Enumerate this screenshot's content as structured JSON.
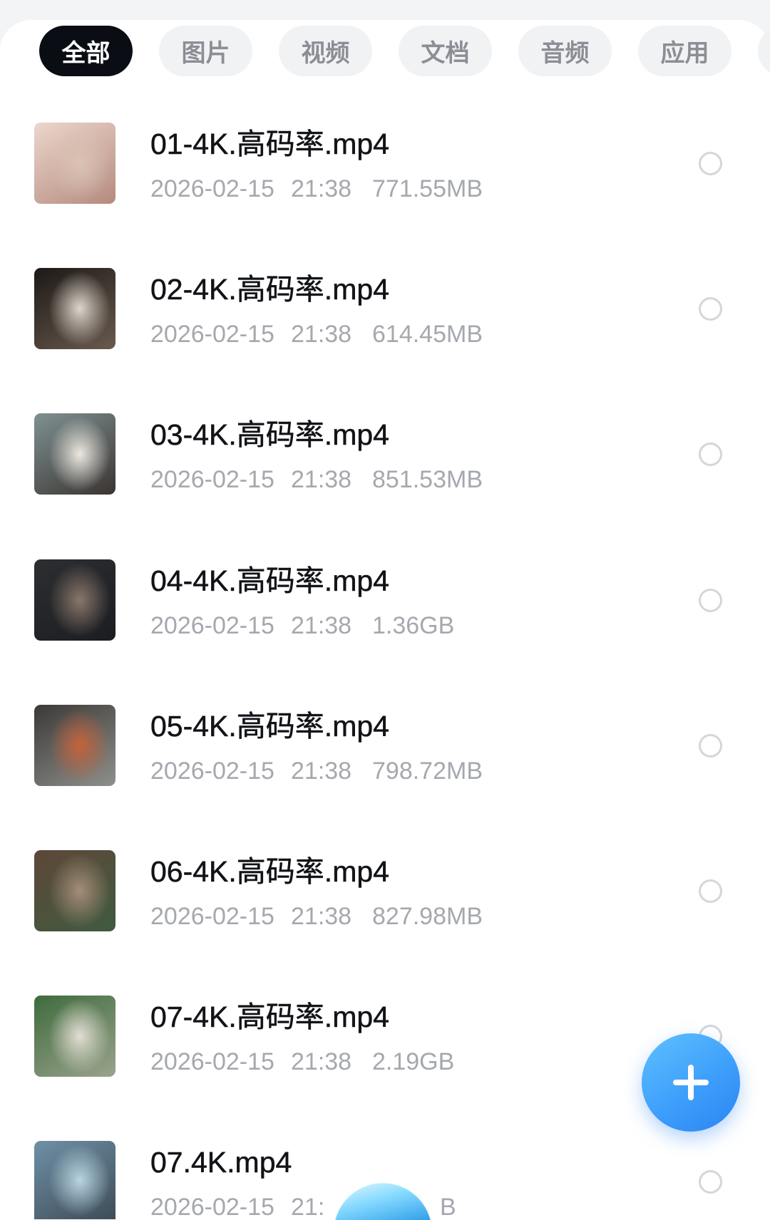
{
  "tabs": [
    {
      "label": "全部",
      "active": true
    },
    {
      "label": "图片",
      "active": false
    },
    {
      "label": "视频",
      "active": false
    },
    {
      "label": "文档",
      "active": false
    },
    {
      "label": "音频",
      "active": false
    },
    {
      "label": "应用",
      "active": false
    }
  ],
  "files": [
    {
      "name": "01-4K.高码率.mp4",
      "date": "2026-02-15",
      "time": "21:38",
      "size": "771.55MB",
      "thumb_colors": [
        "#ecd6cc",
        "#b48b7e",
        "#d9c2b4"
      ]
    },
    {
      "name": "02-4K.高码率.mp4",
      "date": "2026-02-15",
      "time": "21:38",
      "size": "614.45MB",
      "thumb_colors": [
        "#1d1917",
        "#6a5a4e",
        "#dcd6cc"
      ]
    },
    {
      "name": "03-4K.高码率.mp4",
      "date": "2026-02-15",
      "time": "21:38",
      "size": "851.53MB",
      "thumb_colors": [
        "#7f9192",
        "#3a3431",
        "#ece8e0"
      ]
    },
    {
      "name": "04-4K.高码率.mp4",
      "date": "2026-02-15",
      "time": "21:38",
      "size": "1.36GB",
      "thumb_colors": [
        "#2c2e31",
        "#1b1d21",
        "#8a776a"
      ]
    },
    {
      "name": "05-4K.高码率.mp4",
      "date": "2026-02-15",
      "time": "21:38",
      "size": "798.72MB",
      "thumb_colors": [
        "#3b3937",
        "#8e908c",
        "#c4633b"
      ]
    },
    {
      "name": "06-4K.高码率.mp4",
      "date": "2026-02-15",
      "time": "21:38",
      "size": "827.98MB",
      "thumb_colors": [
        "#5e4738",
        "#3f5b40",
        "#a48d78"
      ]
    },
    {
      "name": "07-4K.高码率.mp4",
      "date": "2026-02-15",
      "time": "21:38",
      "size": "2.19GB",
      "thumb_colors": [
        "#3e6b3d",
        "#9aa38c",
        "#e2ded3"
      ]
    },
    {
      "name": "07.4K.mp4",
      "date": "2026-02-15",
      "time": "21:",
      "size": "B",
      "thumb_colors": [
        "#6f90a6",
        "#3e4c58",
        "#b9d5e0"
      ]
    }
  ],
  "fab": {
    "icon": "plus-icon"
  },
  "floating_assistant": {
    "icon": "assistant-bubble-icon"
  },
  "colors": {
    "accent": "#2f8ff7",
    "title": "#111317",
    "meta": "#a5a8ae",
    "tab_active_bg": "#0a0e14",
    "tab_bg": "#f1f2f4",
    "radio_border": "#d4d6da"
  }
}
